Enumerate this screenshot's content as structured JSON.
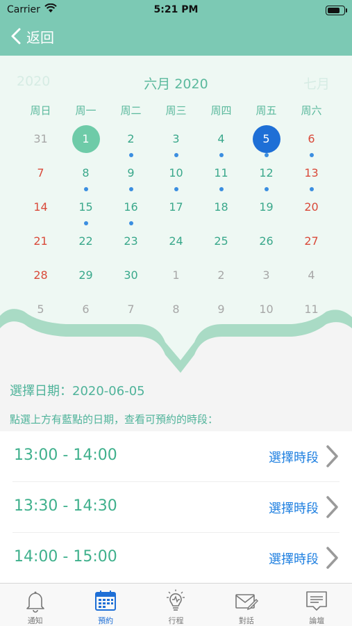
{
  "status_bar": {
    "carrier": "Carrier",
    "time": "5:21 PM",
    "battery_level": 0.8
  },
  "nav": {
    "back_label": "返回"
  },
  "calendar": {
    "prev_month": "2020",
    "current_month": "六月 2020",
    "next_month": "七月",
    "weekdays": [
      "周日",
      "周一",
      "周二",
      "周三",
      "周四",
      "周五",
      "周六"
    ],
    "weeks": [
      [
        {
          "d": "31",
          "muted": true
        },
        {
          "d": "1",
          "today": true
        },
        {
          "d": "2",
          "dot": true
        },
        {
          "d": "3",
          "dot": true
        },
        {
          "d": "4",
          "dot": true
        },
        {
          "d": "5",
          "selected": true,
          "dot": true
        },
        {
          "d": "6",
          "dot": true
        }
      ],
      [
        {
          "d": "7"
        },
        {
          "d": "8",
          "dot": true
        },
        {
          "d": "9",
          "dot": true
        },
        {
          "d": "10",
          "dot": true
        },
        {
          "d": "11",
          "dot": true
        },
        {
          "d": "12",
          "dot": true
        },
        {
          "d": "13",
          "dot": true
        }
      ],
      [
        {
          "d": "14"
        },
        {
          "d": "15",
          "dot": true
        },
        {
          "d": "16",
          "dot": true
        },
        {
          "d": "17"
        },
        {
          "d": "18"
        },
        {
          "d": "19"
        },
        {
          "d": "20"
        }
      ],
      [
        {
          "d": "21"
        },
        {
          "d": "22"
        },
        {
          "d": "23"
        },
        {
          "d": "24"
        },
        {
          "d": "25"
        },
        {
          "d": "26"
        },
        {
          "d": "27"
        }
      ],
      [
        {
          "d": "28"
        },
        {
          "d": "29"
        },
        {
          "d": "30"
        },
        {
          "d": "1",
          "muted": true
        },
        {
          "d": "2",
          "muted": true
        },
        {
          "d": "3",
          "muted": true
        },
        {
          "d": "4",
          "muted": true
        }
      ],
      [
        {
          "d": "5",
          "muted": true
        },
        {
          "d": "6",
          "muted": true
        },
        {
          "d": "7",
          "muted": true
        },
        {
          "d": "8",
          "muted": true
        },
        {
          "d": "9",
          "muted": true
        },
        {
          "d": "10",
          "muted": true
        },
        {
          "d": "11",
          "muted": true
        }
      ]
    ]
  },
  "selection": {
    "selected_date_text": "選擇日期：2020-06-05",
    "hint": "點選上方有藍點的日期，查看可預約的時段："
  },
  "slots": [
    {
      "time": "13:00 - 14:00",
      "action": "選擇時段"
    },
    {
      "time": "13:30 - 14:30",
      "action": "選擇時段"
    },
    {
      "time": "14:00 - 15:00",
      "action": "選擇時段"
    }
  ],
  "tabs": [
    {
      "label": "通知",
      "icon": "bell-icon"
    },
    {
      "label": "預約",
      "icon": "calendar-icon",
      "active": true
    },
    {
      "label": "行程",
      "icon": "lightbulb-icon"
    },
    {
      "label": "對話",
      "icon": "envelope-pen-icon"
    },
    {
      "label": "論壇",
      "icon": "message-board-icon"
    }
  ],
  "colors": {
    "header": "#7cc9b4",
    "accent_green": "#3aa88b",
    "weekend_red": "#d94a3a",
    "selected_blue": "#1e6fd6",
    "dot_blue": "#3b8ee0"
  }
}
